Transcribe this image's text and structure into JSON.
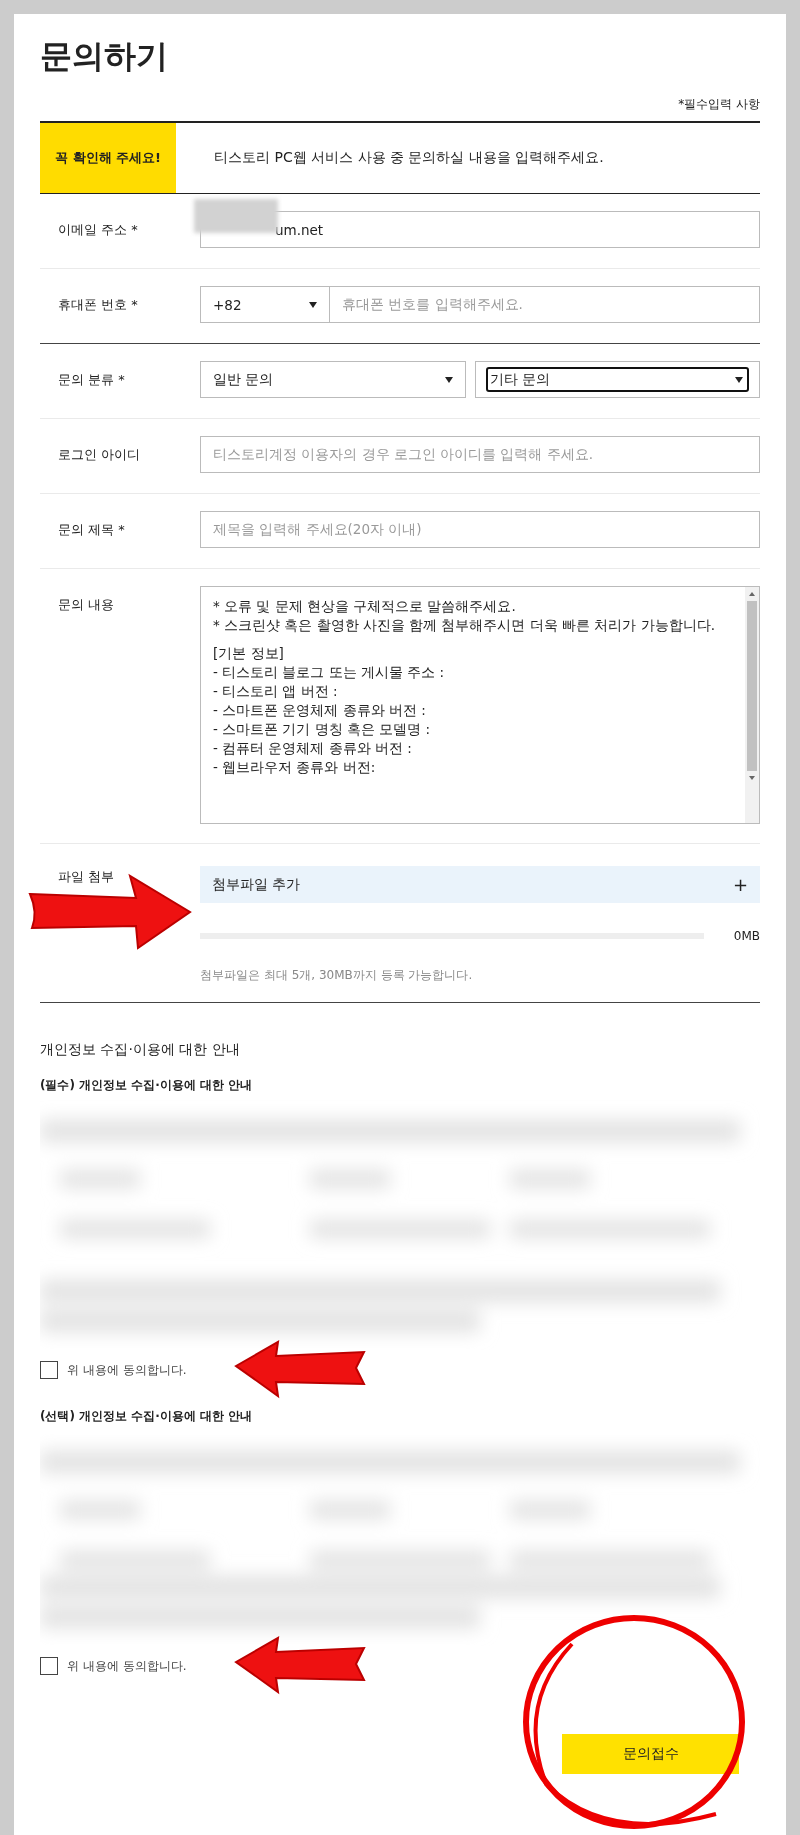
{
  "title": "문의하기",
  "required_note": "*필수입력 사항",
  "notice": {
    "badge": "꼭 확인해 주세요!",
    "text": "티스토리 PC웹 서비스 사용 중 문의하실 내용을 입력해주세요."
  },
  "fields": [
    {
      "kind": "text",
      "label": "이메일 주소 *",
      "value": "um.net",
      "redacted": true,
      "section_end": false
    },
    {
      "kind": "phone",
      "label": "휴대폰 번호 *",
      "code": "+82",
      "placeholder": "휴대폰 번호를 입력해주세요.",
      "section_end": true
    },
    {
      "kind": "selects",
      "label": "문의 분류 *",
      "selects": [
        {
          "value": "일반 문의",
          "focused": false
        },
        {
          "value": "기타 문의",
          "focused": true
        }
      ],
      "section_end": false
    },
    {
      "kind": "text",
      "label": "로그인 아이디",
      "placeholder": "티스토리계정 이용자의 경우 로그인 아이디를 입력해 주세요.",
      "section_end": false
    },
    {
      "kind": "text",
      "label": "문의 제목 *",
      "placeholder": "제목을 입력해 주세요(20자 이내)",
      "section_end": false
    },
    {
      "kind": "textarea",
      "label": "문의 내용",
      "paragraphs": [
        [
          "* 오류 및 문제 현상을 구체적으로 말씀해주세요.",
          "* 스크린샷 혹은 촬영한 사진을 함께 첨부해주시면 더욱 빠른 처리가 가능합니다."
        ],
        [
          "[기본 정보]",
          "- 티스토리 블로그 또는 게시물 주소 :",
          "- 티스토리 앱 버전 :",
          "- 스마트폰 운영체제 종류와 버전 :",
          "- 스마트폰 기기 명칭 혹은 모델명 :",
          "- 컴퓨터 운영체제 종류와 버전 :",
          "- 웹브라우저 종류와 버전:"
        ]
      ],
      "section_end": false
    }
  ],
  "attachment": {
    "label": "파일 첨부",
    "button": "첨부파일 추가",
    "button_icon": "+",
    "level": 0,
    "reading": "0MB",
    "note": "첨부파일은 최대 5개, 30MB까지 등록 가능합니다."
  },
  "privacy": {
    "heading": "개인정보 수집·이용에 대한 안내",
    "sections": [
      {
        "title": "(필수) 개인정보 수집·이용에 대한 안내",
        "agree": {
          "label": "위 내용에 동의합니다.",
          "checked": false
        }
      },
      {
        "title": "(선택) 개인정보 수집·이용에 대한 안내",
        "agree": {
          "label": "위 내용에 동의합니다.",
          "checked": false
        }
      }
    ]
  },
  "submit": "문의접수"
}
